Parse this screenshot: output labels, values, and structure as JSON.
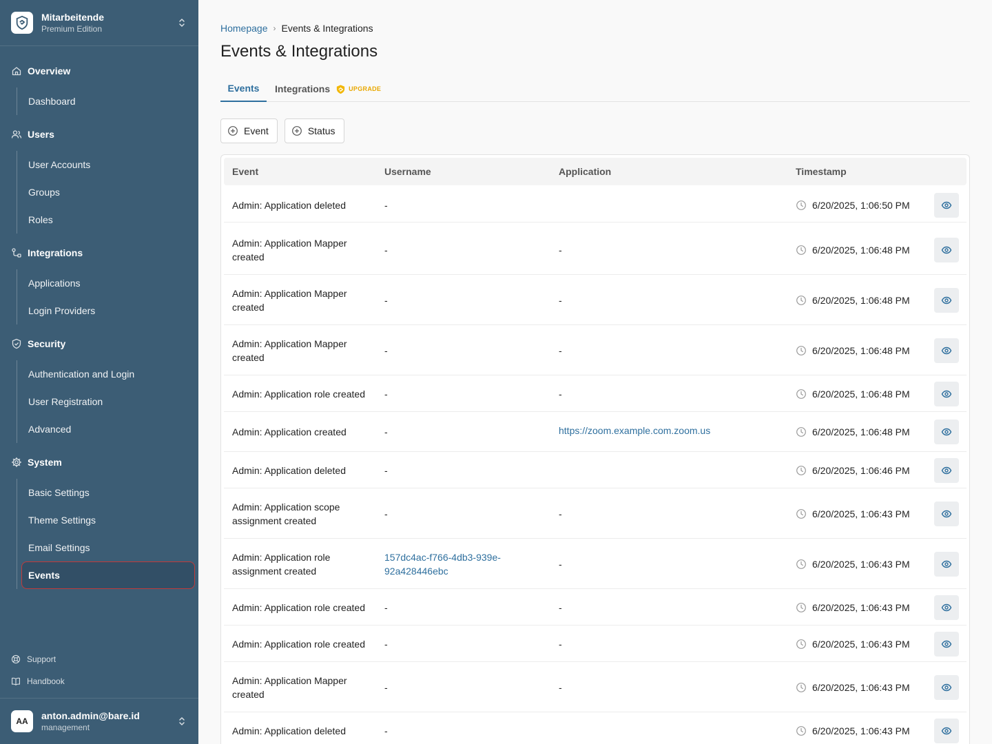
{
  "sidebar": {
    "brand": {
      "name": "Mitarbeitende",
      "edition": "Premium Edition"
    },
    "sections": {
      "overview": {
        "label": "Overview",
        "items": [
          "Dashboard"
        ]
      },
      "users": {
        "label": "Users",
        "items": [
          "User Accounts",
          "Groups",
          "Roles"
        ]
      },
      "integrations": {
        "label": "Integrations",
        "items": [
          "Applications",
          "Login Providers"
        ]
      },
      "security": {
        "label": "Security",
        "items": [
          "Authentication and Login",
          "User Registration",
          "Advanced"
        ]
      },
      "system": {
        "label": "System",
        "items": [
          "Basic Settings",
          "Theme Settings",
          "Email Settings",
          "Events"
        ]
      }
    },
    "footer": {
      "support": "Support",
      "handbook": "Handbook"
    },
    "user": {
      "initials": "AA",
      "email": "anton.admin@bare.id",
      "role": "management"
    }
  },
  "breadcrumb": {
    "home": "Homepage",
    "current": "Events & Integrations"
  },
  "page_title": "Events & Integrations",
  "tabs": {
    "events": "Events",
    "integrations": "Integrations",
    "upgrade": "UPGRADE"
  },
  "filters": {
    "event": "Event",
    "status": "Status"
  },
  "table": {
    "headers": {
      "event": "Event",
      "username": "Username",
      "application": "Application",
      "timestamp": "Timestamp"
    },
    "rows": [
      {
        "event": "Admin: Application deleted",
        "username": "-",
        "application": "",
        "timestamp": "6/20/2025, 1:06:50 PM"
      },
      {
        "event": "Admin: Application Mapper created",
        "username": "-",
        "application": "-",
        "timestamp": "6/20/2025, 1:06:48 PM"
      },
      {
        "event": "Admin: Application Mapper created",
        "username": "-",
        "application": "-",
        "timestamp": "6/20/2025, 1:06:48 PM"
      },
      {
        "event": "Admin: Application Mapper created",
        "username": "-",
        "application": "-",
        "timestamp": "6/20/2025, 1:06:48 PM"
      },
      {
        "event": "Admin: Application role created",
        "username": "-",
        "application": "-",
        "timestamp": "6/20/2025, 1:06:48 PM"
      },
      {
        "event": "Admin: Application created",
        "username": "-",
        "application": "https://zoom.example.com.zoom.us",
        "timestamp": "6/20/2025, 1:06:48 PM"
      },
      {
        "event": "Admin: Application deleted",
        "username": "-",
        "application": "",
        "timestamp": "6/20/2025, 1:06:46 PM"
      },
      {
        "event": "Admin: Application scope assignment created",
        "username": "-",
        "application": "-",
        "timestamp": "6/20/2025, 1:06:43 PM"
      },
      {
        "event": "Admin: Application role assignment created",
        "username": "157dc4ac-f766-4db3-939e-92a428446ebc",
        "application": "-",
        "timestamp": "6/20/2025, 1:06:43 PM"
      },
      {
        "event": "Admin: Application role created",
        "username": "-",
        "application": "-",
        "timestamp": "6/20/2025, 1:06:43 PM"
      },
      {
        "event": "Admin: Application role created",
        "username": "-",
        "application": "-",
        "timestamp": "6/20/2025, 1:06:43 PM"
      },
      {
        "event": "Admin: Application Mapper created",
        "username": "-",
        "application": "-",
        "timestamp": "6/20/2025, 1:06:43 PM"
      },
      {
        "event": "Admin: Application deleted",
        "username": "-",
        "application": "",
        "timestamp": "6/20/2025, 1:06:43 PM"
      }
    ]
  },
  "colors": {
    "sidebar_bg": "#3c5d75",
    "accent": "#2e6f9e",
    "upgrade": "#e9a800",
    "active_outline": "#c23a3a"
  }
}
